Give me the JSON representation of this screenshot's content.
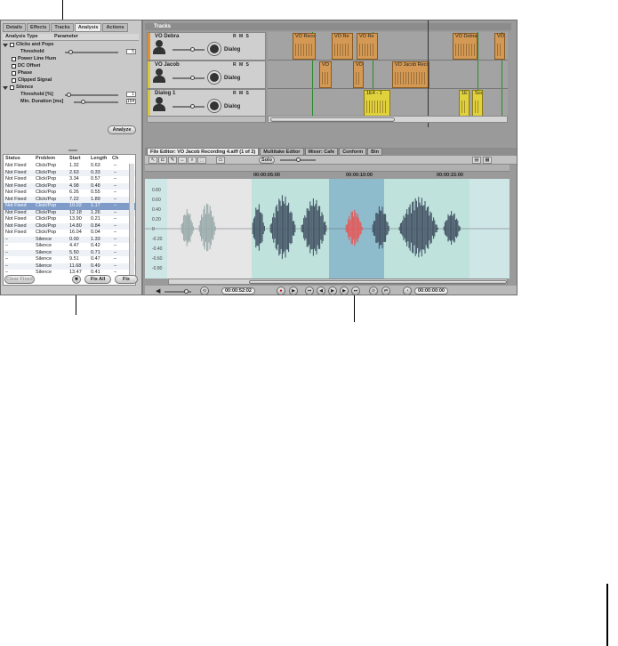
{
  "left_panel": {
    "tabs": [
      "Details",
      "Effects",
      "Tracks",
      "Analysis",
      "Actions"
    ],
    "analysis_header": {
      "type": "Analysis Type",
      "parameter": "Parameter"
    },
    "analysis_items": [
      {
        "label": "Clicks and Pops",
        "kind": "group"
      },
      {
        "label": "Threshold",
        "kind": "param",
        "value": "5"
      },
      {
        "label": "Power Line Hum",
        "kind": "check"
      },
      {
        "label": "DC Offset",
        "kind": "check"
      },
      {
        "label": "Phase",
        "kind": "check"
      },
      {
        "label": "Clipped Signal",
        "kind": "check"
      },
      {
        "label": "Silence",
        "kind": "group"
      },
      {
        "label": "Threshold [%]",
        "kind": "param",
        "value": "1"
      },
      {
        "label": "Min. Duration [ms]",
        "kind": "param",
        "value": "164"
      }
    ],
    "analyze_button": "Analyze",
    "table_headers": [
      "Status",
      "Problem",
      "Start",
      "Length",
      "Ch"
    ],
    "table_rows": [
      [
        "Not Fixed",
        "Click/Pop",
        "1.32",
        "0.63",
        "–"
      ],
      [
        "Not Fixed",
        "Click/Pop",
        "2.63",
        "0.33",
        "–"
      ],
      [
        "Not Fixed",
        "Click/Pop",
        "3.34",
        "0.57",
        "–"
      ],
      [
        "Not Fixed",
        "Click/Pop",
        "4.98",
        "0.48",
        "–"
      ],
      [
        "Not Fixed",
        "Click/Pop",
        "6.26",
        "0.55",
        "–"
      ],
      [
        "Not Fixed",
        "Click/Pop",
        "7.22",
        "1.89",
        "–"
      ],
      [
        "Not Fixed",
        "Click/Pop",
        "10.02",
        "1.17",
        "–"
      ],
      [
        "Not Fixed",
        "Click/Pop",
        "12.18",
        "1.26",
        "–"
      ],
      [
        "Not Fixed",
        "Click/Pop",
        "13.90",
        "0.21",
        "–"
      ],
      [
        "Not Fixed",
        "Click/Pop",
        "14.80",
        "0.84",
        "–"
      ],
      [
        "Not Fixed",
        "Click/Pop",
        "16.04",
        "0.04",
        "–"
      ],
      [
        "–",
        "Silence",
        "0.00",
        "1.33",
        "–"
      ],
      [
        "–",
        "Silence",
        "4.47",
        "0.42",
        "–"
      ],
      [
        "–",
        "Silence",
        "5.50",
        "0.71",
        "–"
      ],
      [
        "–",
        "Silence",
        "9.51",
        "0.47",
        "–"
      ],
      [
        "–",
        "Silence",
        "11.68",
        "0.49",
        "–"
      ],
      [
        "–",
        "Silence",
        "13.47",
        "0.41",
        "–"
      ]
    ],
    "selected_row": 6,
    "clear_fixed": "Clear Fixed",
    "fix_all": "Fix All",
    "fix": "Fix"
  },
  "tracks": {
    "header": "Tracks",
    "list": [
      {
        "name": "VO Debra",
        "output": "Dialog",
        "color": "#e0902c",
        "clips": [
          {
            "label": "VO Recor"
          },
          {
            "label": "VO Re"
          },
          {
            "label": "VO Re"
          },
          {
            "label": "VO Debra"
          },
          {
            "label": "VO"
          }
        ]
      },
      {
        "name": "VO Jacob",
        "output": "Dialog",
        "color": "#d9c83a",
        "clips": [
          {
            "label": "VO"
          },
          {
            "label": "VO"
          },
          {
            "label": "VO Jacob Recori"
          }
        ]
      },
      {
        "name": "Dialog 1",
        "output": "Dialog",
        "color": "#d9c83a",
        "clips": [
          {
            "label": "1E4 - 1"
          },
          {
            "label": "1E"
          },
          {
            "label": "Scei"
          }
        ]
      }
    ],
    "track_buttons": "R M S"
  },
  "editor": {
    "tabs": [
      "File Editor: VO Jacob Recording 4.aiff (1 of 2)",
      "Multitake Editor",
      "Mixer: Cafe",
      "Conform",
      "Bin"
    ],
    "solo": "Solo",
    "timecodes": [
      "00:00:05:00",
      "00:00:10:00",
      "00:00:15:00"
    ],
    "db_labels": [
      "0.80",
      "0.60",
      "0.40",
      "0.20",
      "0",
      "-0.20",
      "-0.40",
      "-0.60",
      "-0.80"
    ]
  },
  "transport": {
    "timecode": "00:00:52:02",
    "duration": "00:00:00:00"
  }
}
